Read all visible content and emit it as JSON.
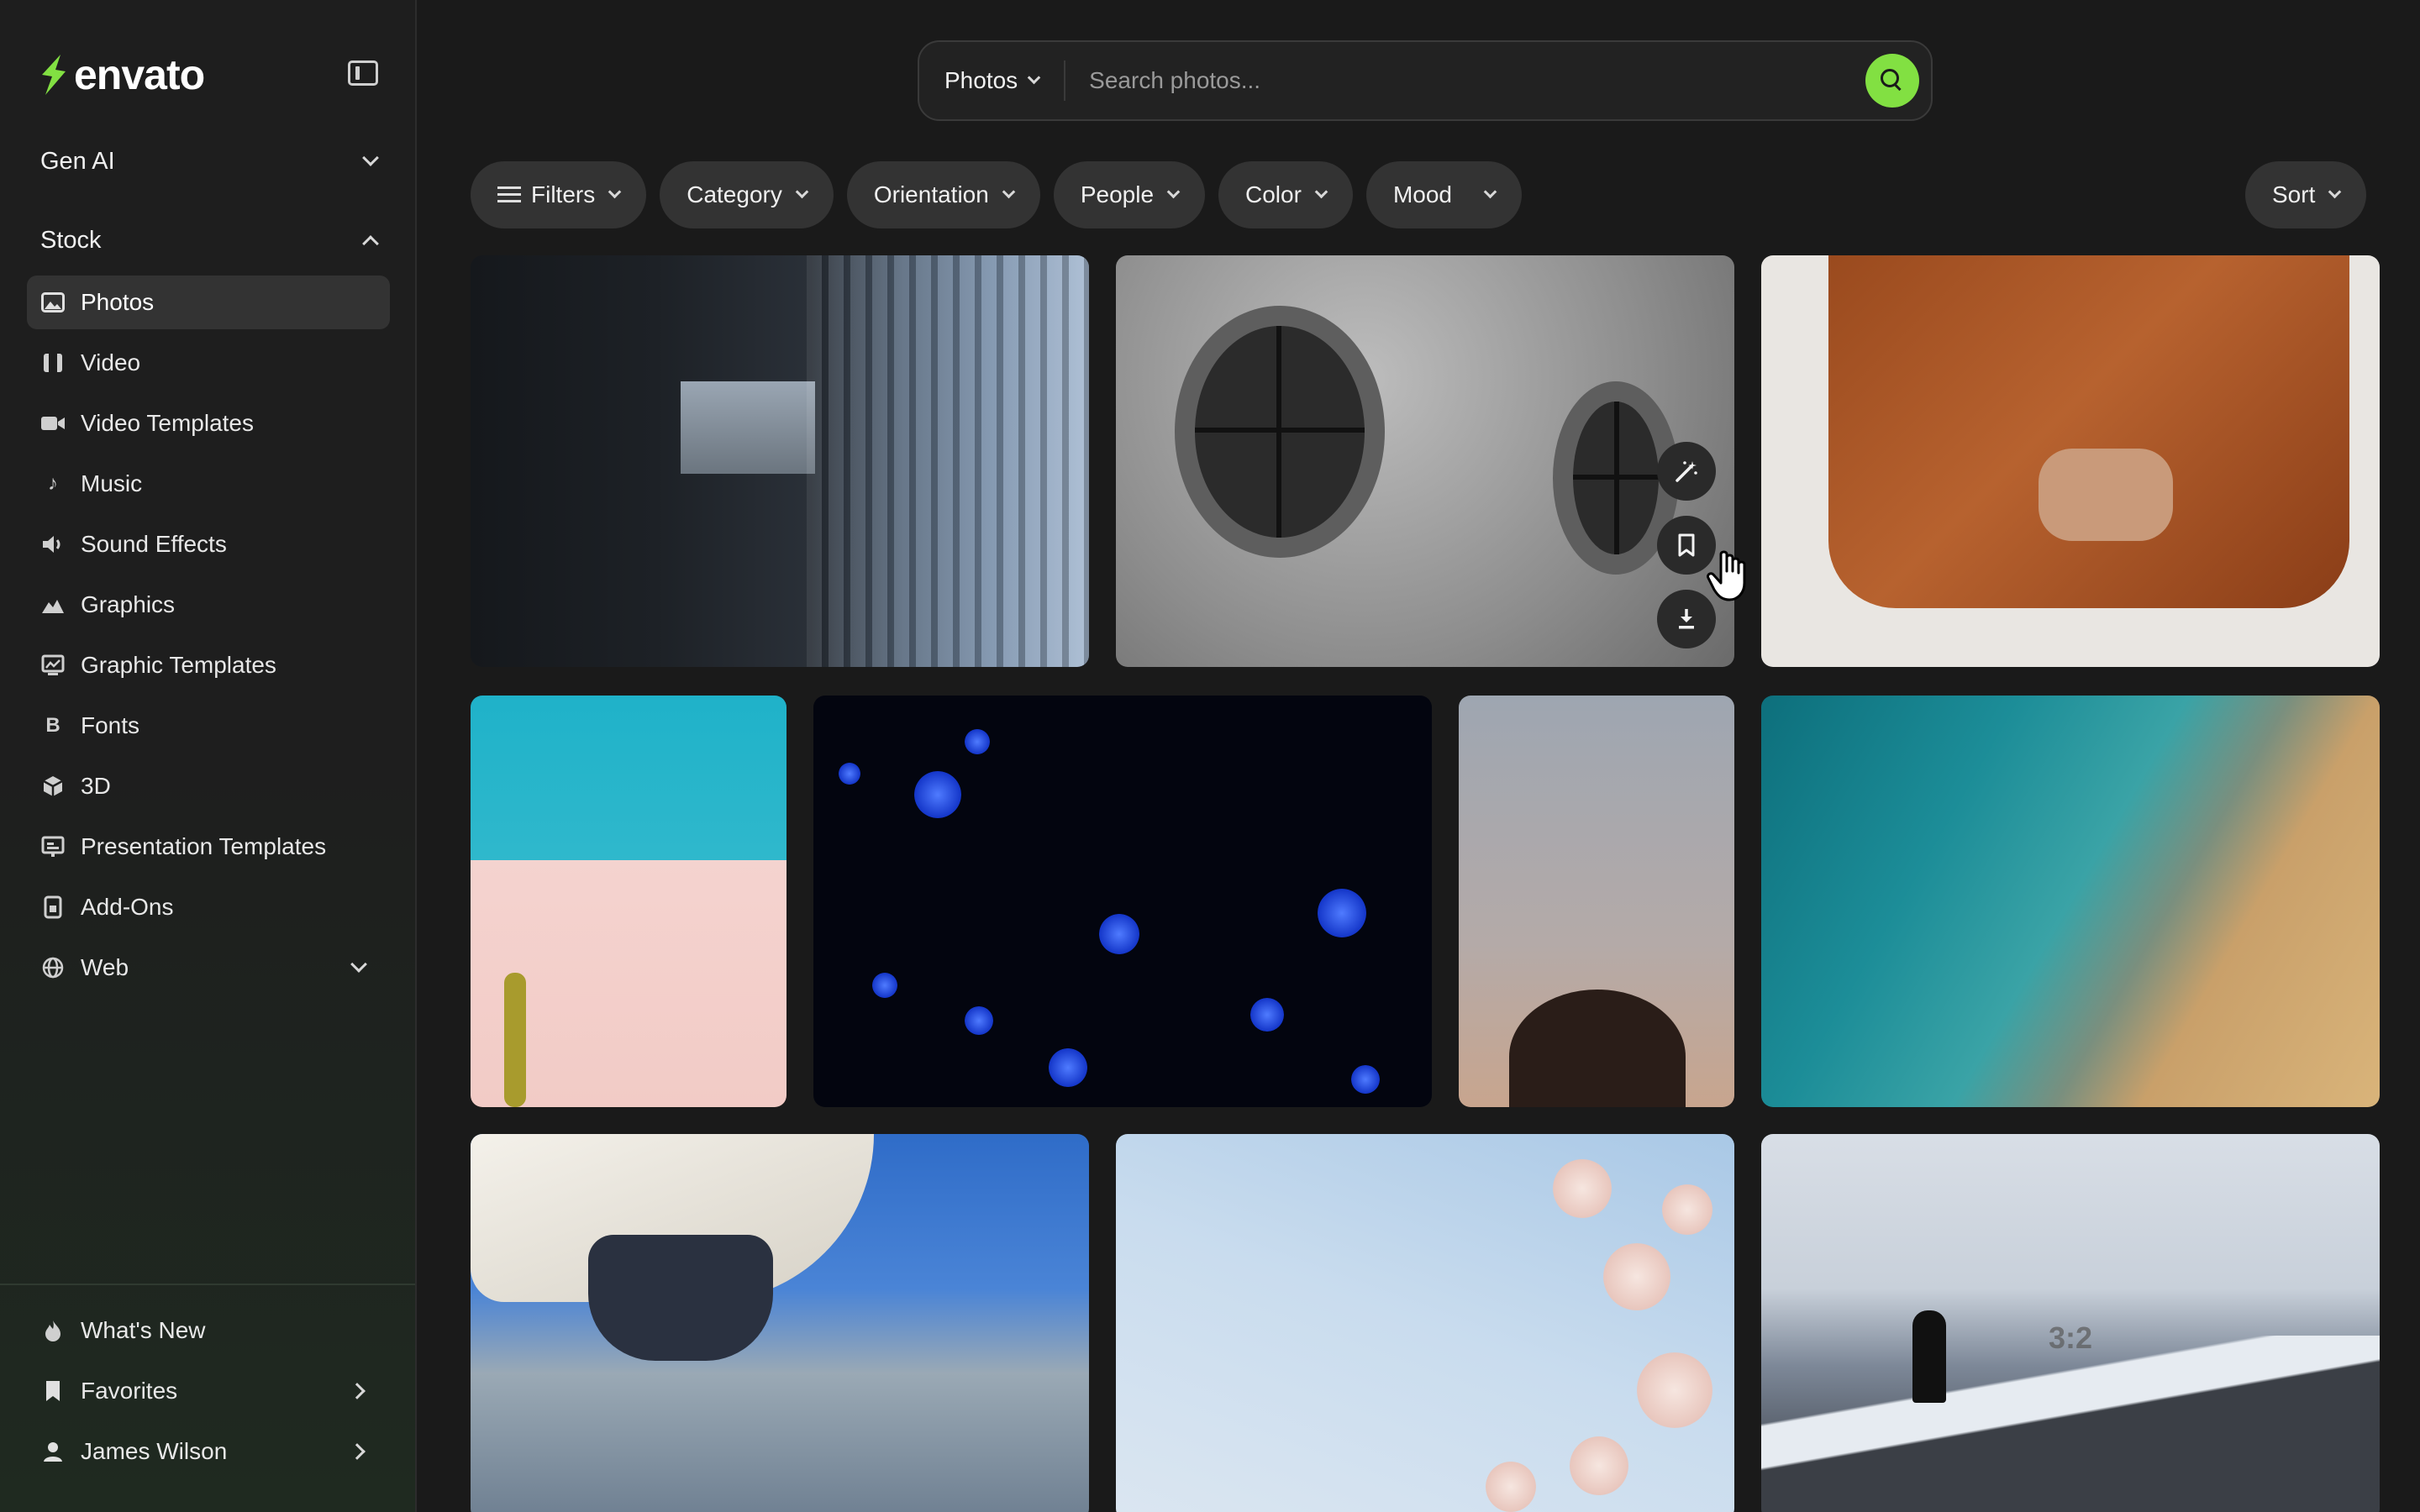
{
  "brand": {
    "name": "envato",
    "accent": "#82e042"
  },
  "sidebar": {
    "gen_ai": "Gen AI",
    "stock": "Stock",
    "items": [
      {
        "label": "Photos",
        "icon": "image-icon",
        "active": true
      },
      {
        "label": "Video",
        "icon": "film-icon"
      },
      {
        "label": "Video Templates",
        "icon": "video-camera-icon"
      },
      {
        "label": "Music",
        "icon": "music-note-icon"
      },
      {
        "label": "Sound Effects",
        "icon": "speaker-icon"
      },
      {
        "label": "Graphics",
        "icon": "landscape-icon"
      },
      {
        "label": "Graphic Templates",
        "icon": "template-icon"
      },
      {
        "label": "Fonts",
        "icon": "font-b-icon"
      },
      {
        "label": "3D",
        "icon": "cube-icon"
      },
      {
        "label": "Presentation Templates",
        "icon": "presentation-icon"
      },
      {
        "label": "Add-Ons",
        "icon": "add-on-icon"
      },
      {
        "label": "Web",
        "icon": "globe-icon"
      }
    ],
    "footer": [
      {
        "label": "What's New",
        "icon": "flame-icon"
      },
      {
        "label": "Favorites",
        "icon": "bookmark-icon"
      },
      {
        "label": "James Wilson",
        "icon": "user-icon"
      }
    ]
  },
  "search": {
    "type": "Photos",
    "placeholder": "Search photos..."
  },
  "filters": [
    "Filters",
    "Category",
    "Orientation",
    "People",
    "Color",
    "Mood"
  ],
  "sort": "Sort",
  "photo_overlay": {
    "ratio": "3:2"
  }
}
